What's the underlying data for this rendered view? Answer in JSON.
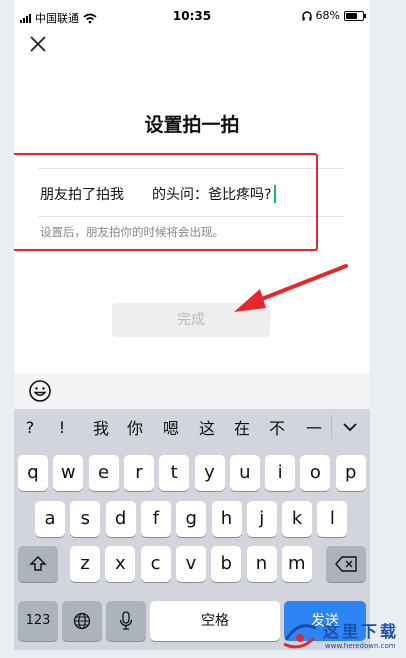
{
  "status_bar": {
    "carrier": "中国联通",
    "time": "10:35",
    "battery_percent": "68%",
    "battery_level": 0.68
  },
  "page": {
    "title": "设置拍一拍",
    "input_prefix": "朋友拍了拍我",
    "input_value": "的头问：爸比疼吗?",
    "hint": "设置后，朋友拍你的时候将会出现。",
    "done_label": "完成"
  },
  "annotation": {
    "box_color": "#e8262c",
    "arrow_color": "#e8262c"
  },
  "keyboard": {
    "candidates": [
      "?",
      "!",
      "我",
      "你",
      "嗯",
      "这",
      "在",
      "不",
      "一"
    ],
    "row1": [
      "q",
      "w",
      "e",
      "r",
      "t",
      "y",
      "u",
      "i",
      "o",
      "p"
    ],
    "row2": [
      "a",
      "s",
      "d",
      "f",
      "g",
      "h",
      "j",
      "k",
      "l"
    ],
    "row3": [
      "z",
      "x",
      "c",
      "v",
      "b",
      "n",
      "m"
    ],
    "numbers_label": "123",
    "space_label": "空格",
    "send_label": "发送",
    "accent": "#2d84f4"
  },
  "watermark": {
    "text": "这里下载",
    "url": "www.heredown.com"
  }
}
